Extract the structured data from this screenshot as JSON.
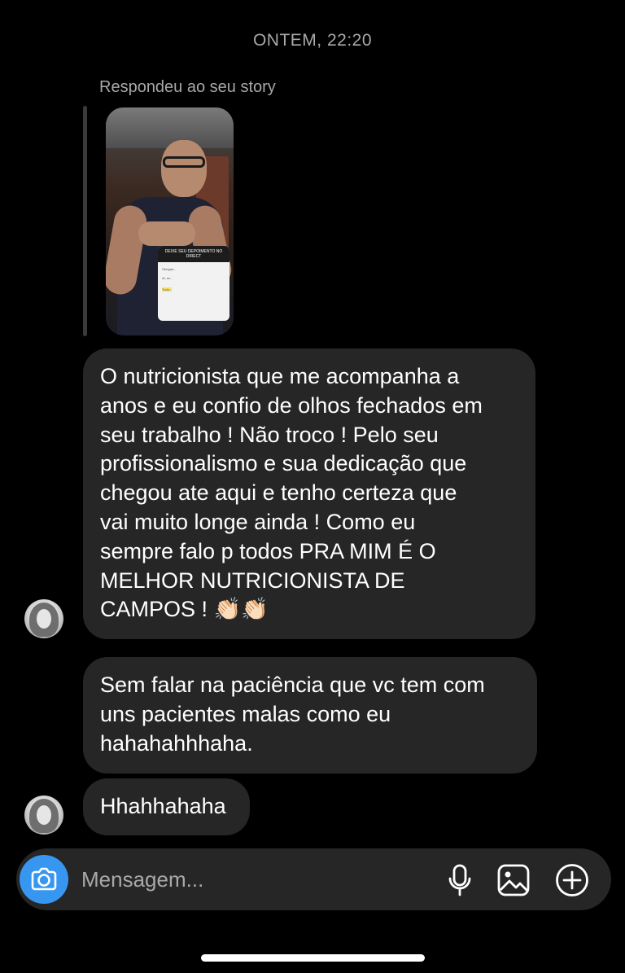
{
  "conversation": {
    "timestamp": "ONTEM, 22:20",
    "story_reply_label": "Respondeu ao seu story",
    "story_card": {
      "title": "DEIXE SEU DEPOIMENTO NO DIRECT",
      "lines": [
        "Obrigad...",
        "Ai, se... ",
        "Tudo..."
      ]
    },
    "messages": [
      {
        "text": "O nutricionista que me acompanha a\nanos e eu confio de olhos fechados em\nseu trabalho ! Não troco ! Pelo seu\nprofissionalismo e sua dedicação que\nchegou ate aqui e tenho certeza que\nvai muito longe ainda ! Como eu\nsempre falo p todos PRA MIM É O\nMELHOR NUTRICIONISTA DE\nCAMPOS ! 👏🏻👏🏻"
      },
      {
        "text": "Sem falar na paciência que vc tem com\nuns pacientes malas como eu\nhahahahhhaha."
      },
      {
        "text": "Hhahhahaha"
      }
    ]
  },
  "composer": {
    "placeholder": "Mensagem...",
    "value": ""
  },
  "icons": {
    "camera": "camera-icon",
    "mic": "microphone-icon",
    "gallery": "image-gallery-icon",
    "add": "plus-circle-icon"
  },
  "colors": {
    "background": "#000000",
    "bubble": "#262626",
    "accent": "#3797f0",
    "secondary_text": "#a8a8a8"
  }
}
